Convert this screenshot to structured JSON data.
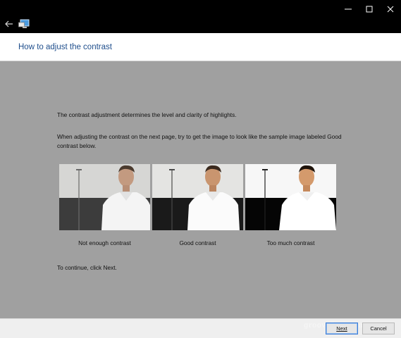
{
  "window": {
    "controls": [
      {
        "name": "minimize-button",
        "icon": "minimize-icon"
      },
      {
        "name": "maximize-button",
        "icon": "maximize-icon"
      },
      {
        "name": "close-button",
        "icon": "close-icon"
      }
    ],
    "back_icon": "back-arrow-icon",
    "app_icon": "display-settings-icon"
  },
  "header": {
    "title": "How to adjust the contrast"
  },
  "body": {
    "intro": "The contrast adjustment determines the level and clarity of highlights.",
    "instruction": "When adjusting the contrast on the next page, try to get the image to look like the sample image labeled Good contrast below.",
    "continue": "To continue, click Next."
  },
  "samples": [
    {
      "caption": "Not enough contrast",
      "variant": "low"
    },
    {
      "caption": "Good contrast",
      "variant": "good"
    },
    {
      "caption": "Too much contrast",
      "variant": "high"
    }
  ],
  "footer": {
    "next_label": "Next",
    "cancel_label": "Cancel",
    "watermark": "groovyPost.com"
  },
  "colors": {
    "titlebar": "#000000",
    "header_bg": "#ffffff",
    "title_text": "#1f4e8c",
    "content_bg": "#a0a0a0",
    "footer_bg": "#efefef",
    "focus_border": "#3a7bd5"
  }
}
